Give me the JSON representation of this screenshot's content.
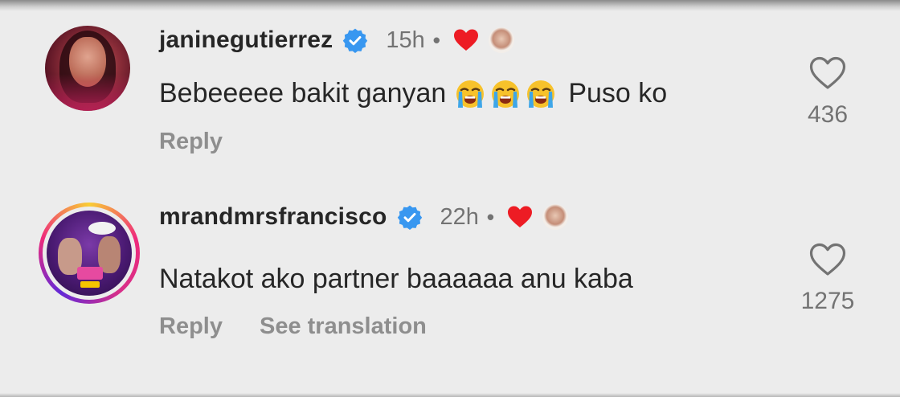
{
  "colors": {
    "verified": "#3897f0",
    "liked_heart": "#ed1c24",
    "username": "#262626",
    "meta": "#737373",
    "action": "#8e8e8e",
    "background": "#ececec"
  },
  "comments": [
    {
      "username": "janinegutierrez",
      "verified": true,
      "time": "15h",
      "separator": "•",
      "liked_by_author": true,
      "text_before": "Bebeeeee bakit ganyan",
      "emojis": [
        "loudly-crying-face",
        "loudly-crying-face",
        "loudly-crying-face"
      ],
      "text_after": "Puso ko",
      "actions": [
        "Reply"
      ],
      "like_count": "436",
      "avatar_story_ring": false
    },
    {
      "username": "mrandmrsfrancisco",
      "verified": true,
      "time": "22h",
      "separator": "•",
      "liked_by_author": true,
      "text": "Natakot ako partner baaaaaa anu kaba",
      "actions": [
        "Reply",
        "See translation"
      ],
      "like_count": "1275",
      "avatar_story_ring": true
    }
  ]
}
